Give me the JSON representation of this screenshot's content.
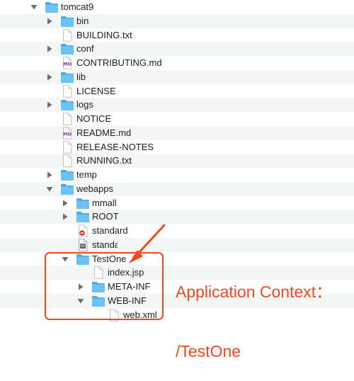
{
  "tree": [
    {
      "name": "tomcat9",
      "type": "folder",
      "depth": 0,
      "expanded": true
    },
    {
      "name": "bin",
      "type": "folder",
      "depth": 1,
      "expanded": false
    },
    {
      "name": "BUILDING.txt",
      "type": "file",
      "depth": 1
    },
    {
      "name": "conf",
      "type": "folder",
      "depth": 1,
      "expanded": false
    },
    {
      "name": "CONTRIBUTING.md",
      "type": "md",
      "depth": 1
    },
    {
      "name": "lib",
      "type": "folder",
      "depth": 1,
      "expanded": false
    },
    {
      "name": "LICENSE",
      "type": "file",
      "depth": 1
    },
    {
      "name": "logs",
      "type": "folder",
      "depth": 1,
      "expanded": false
    },
    {
      "name": "NOTICE",
      "type": "file",
      "depth": 1
    },
    {
      "name": "README.md",
      "type": "md",
      "depth": 1
    },
    {
      "name": "RELEASE-NOTES",
      "type": "file",
      "depth": 1
    },
    {
      "name": "RUNNING.txt",
      "type": "file",
      "depth": 1
    },
    {
      "name": "temp",
      "type": "folder",
      "depth": 1,
      "expanded": false
    },
    {
      "name": "webapps",
      "type": "folder",
      "depth": 1,
      "expanded": true
    },
    {
      "name": "mmall",
      "type": "folder",
      "depth": 2,
      "expanded": false
    },
    {
      "name": "ROOT",
      "type": "folder",
      "depth": 2,
      "expanded": false
    },
    {
      "name": "standard",
      "type": "alias",
      "depth": 2
    },
    {
      "name": "standard.war",
      "type": "war",
      "depth": 2
    },
    {
      "name": "TestOne",
      "type": "folder",
      "depth": 2,
      "expanded": true
    },
    {
      "name": "index.jsp",
      "type": "file",
      "depth": 3
    },
    {
      "name": "META-INF",
      "type": "folder",
      "depth": 3,
      "expanded": false
    },
    {
      "name": "WEB-INF",
      "type": "folder",
      "depth": 3,
      "expanded": true
    },
    {
      "name": "web.xml",
      "type": "file",
      "depth": 4
    }
  ],
  "annotation": {
    "line1": "Application Context：",
    "line2": "/TestOne",
    "color": "#f2491f"
  },
  "colors": {
    "folder_front": "#6cc2f5",
    "folder_back": "#4aa8e8",
    "stripe": "#f4f5f5",
    "md_badge": "#8a3aa0"
  }
}
